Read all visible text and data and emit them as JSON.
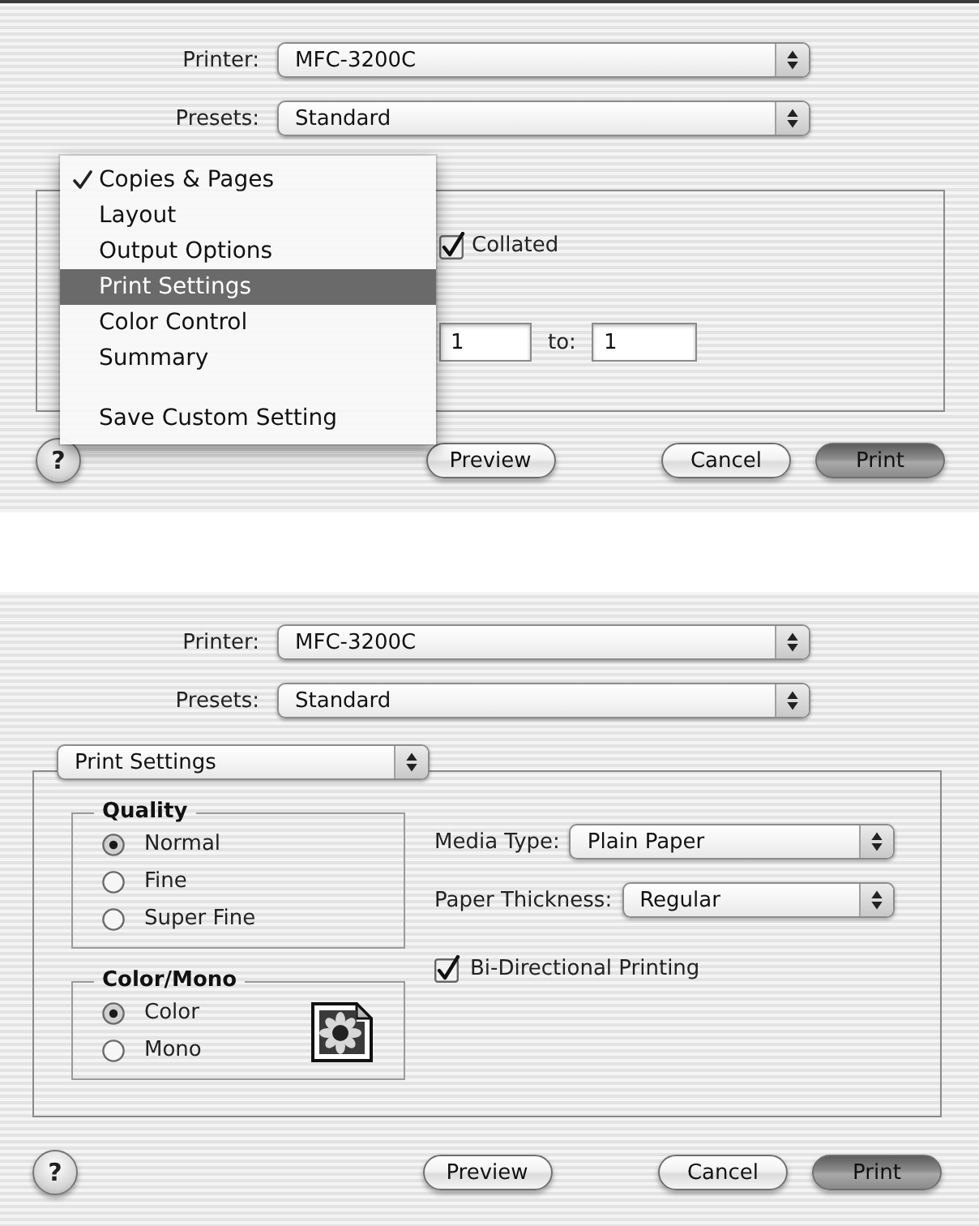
{
  "dialogs": [
    {
      "kind": "copies_pages",
      "printer": {
        "label": "Printer:",
        "value": "MFC-3200C"
      },
      "presets": {
        "label": "Presets:",
        "value": "Standard"
      },
      "pane_menu": {
        "groups": [
          {
            "items": [
              {
                "label": "Copies & Pages",
                "checked": true,
                "selected": false
              },
              {
                "label": "Layout",
                "checked": false,
                "selected": false
              },
              {
                "label": "Output Options",
                "checked": false,
                "selected": false
              },
              {
                "label": "Print Settings",
                "checked": false,
                "selected": true
              },
              {
                "label": "Color Control",
                "checked": false,
                "selected": false
              },
              {
                "label": "Summary",
                "checked": false,
                "selected": false
              }
            ]
          },
          {
            "items": [
              {
                "label": "Save Custom Setting",
                "checked": false,
                "selected": false
              }
            ]
          }
        ]
      },
      "collated": {
        "label": "Collated",
        "checked": true
      },
      "page_range": {
        "from_value": "1",
        "to_label": "to:",
        "to_value": "1"
      },
      "help": "?",
      "buttons": [
        {
          "label": "Preview",
          "default": false
        },
        {
          "label": "Cancel",
          "default": false
        },
        {
          "label": "Print",
          "default": true
        }
      ]
    },
    {
      "kind": "print_settings",
      "printer": {
        "label": "Printer:",
        "value": "MFC-3200C"
      },
      "presets": {
        "label": "Presets:",
        "value": "Standard"
      },
      "pane_popup": {
        "value": "Print Settings"
      },
      "quality": {
        "title": "Quality",
        "options": [
          {
            "label": "Normal",
            "selected": true
          },
          {
            "label": "Fine",
            "selected": false
          },
          {
            "label": "Super Fine",
            "selected": false
          }
        ]
      },
      "color_mode": {
        "title": "Color/Mono",
        "options": [
          {
            "label": "Color",
            "selected": true
          },
          {
            "label": "Mono",
            "selected": false
          }
        ]
      },
      "media_type": {
        "label": "Media Type:",
        "value": "Plain Paper"
      },
      "paper_thickness": {
        "label": "Paper Thickness:",
        "value": "Regular"
      },
      "bidirectional": {
        "label": "Bi-Directional Printing",
        "checked": true
      },
      "help": "?",
      "buttons": [
        {
          "label": "Preview",
          "default": false
        },
        {
          "label": "Cancel",
          "default": false
        },
        {
          "label": "Print",
          "default": true
        }
      ]
    }
  ]
}
